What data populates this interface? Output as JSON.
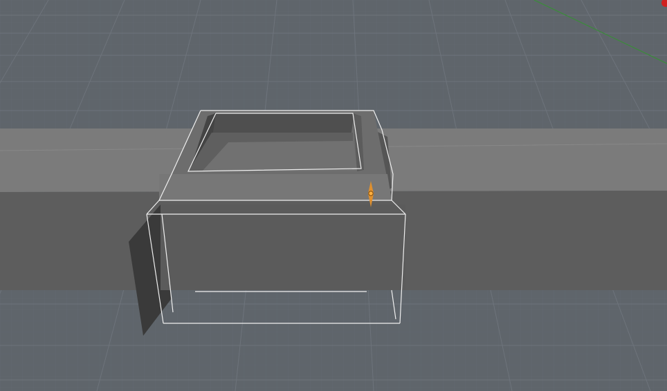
{
  "viewport": {
    "kind": "3d-viewport",
    "view": "perspective",
    "colors": {
      "floor": "#5f656b",
      "grid_minor": "#6a7076",
      "grid_major": "#737980",
      "wall_top": "#7c7c7c",
      "wall_front": "#5d5d5d",
      "box_top": "#6e6e6e",
      "box_front": "#5b5b5b",
      "pocket_floor": "#717171",
      "pocket_inner": "#505050",
      "shadow": "#3a3a3a",
      "selection_outline": "#f0f0f0",
      "gizmo": "#e0902e",
      "axis_x": "#d02020",
      "axis_y": "#3c8a3c"
    },
    "selection": {
      "active": true,
      "outline_color": "#f0f0f0"
    },
    "object_origin_icon": "object-origin-icon",
    "navigation_axis": {
      "x_color": "#d02020",
      "y_color": "#3c8a3c"
    }
  }
}
